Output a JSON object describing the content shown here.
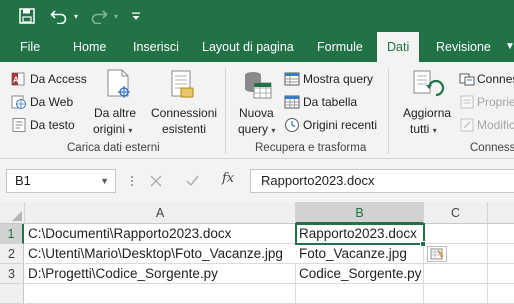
{
  "quick_access": {
    "save": "save-icon",
    "undo": "undo-icon",
    "redo": "redo-icon",
    "customize": "customize-caret-icon"
  },
  "tabs": [
    {
      "label": "File"
    },
    {
      "label": "Home"
    },
    {
      "label": "Inserisci"
    },
    {
      "label": "Layout di pagina"
    },
    {
      "label": "Formule"
    },
    {
      "label": "Dati"
    },
    {
      "label": "Revisione"
    }
  ],
  "ribbon": {
    "get_external": {
      "from_access": "Da Access",
      "from_web": "Da Web",
      "from_text": "Da testo",
      "other_sources_1": "Da altre",
      "other_sources_2": "origini",
      "existing_1": "Connessioni",
      "existing_2": "esistenti",
      "group_label": "Carica dati esterni"
    },
    "get_transform": {
      "new_query_1": "Nuova",
      "new_query_2": "query",
      "show_queries": "Mostra query",
      "from_table": "Da tabella",
      "recent_sources": "Origini recenti",
      "group_label": "Recupera e trasforma"
    },
    "connections": {
      "refresh_1": "Aggiorna",
      "refresh_2": "tutti",
      "connections": "Conness",
      "properties": "Proprie",
      "edit_links": "Modific",
      "group_label": "Conness"
    }
  },
  "formula_bar": {
    "name_box": "B1",
    "fx": "fx",
    "content": "Rapporto2023.docx"
  },
  "grid": {
    "columns": [
      "A",
      "B",
      "C"
    ],
    "rows": [
      {
        "num": "1",
        "a": "C:\\Documenti\\Rapporto2023.docx",
        "b": "Rapporto2023.docx"
      },
      {
        "num": "2",
        "a": "C:\\Utenti\\Mario\\Desktop\\Foto_Vacanze.jpg",
        "b": "Foto_Vacanze.jpg"
      },
      {
        "num": "3",
        "a": "D:\\Progetti\\Codice_Sorgente.py",
        "b": "Codice_Sorgente.py"
      }
    ],
    "active_cell": "B1",
    "flash_fill_icon": "flash-fill-options-icon"
  },
  "colors": {
    "accent": "#217346",
    "ribbon_bg": "#f3f3f3",
    "header_bg": "#efefef"
  }
}
